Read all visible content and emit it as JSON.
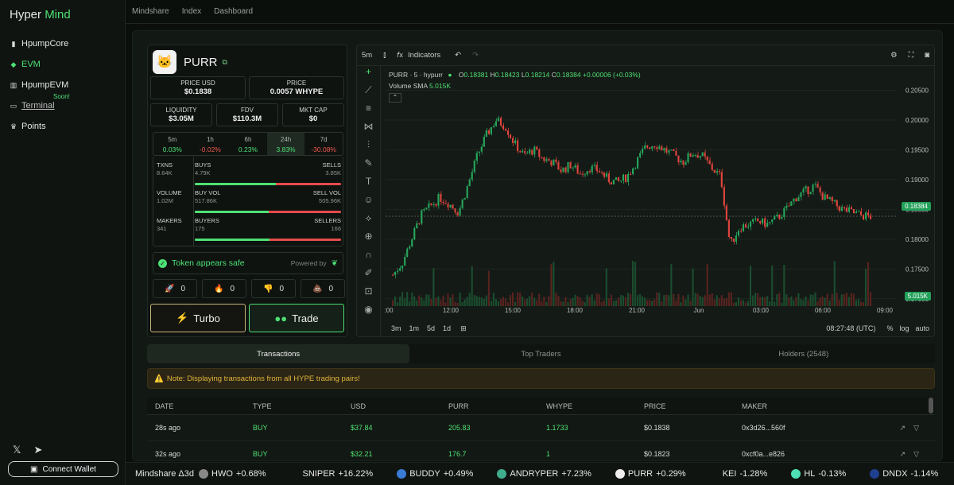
{
  "brand": {
    "part1": "Hyper",
    "part2": "Mind"
  },
  "sidebar": {
    "items": [
      {
        "label": "HpumpCore",
        "icon": "book-icon"
      },
      {
        "label": "EVM",
        "icon": "layers-icon"
      },
      {
        "label": "HpumpEVM",
        "icon": "bar-chart-icon"
      },
      {
        "label": "Terminal",
        "icon": "terminal-icon",
        "badge": "Soon!"
      },
      {
        "label": "Points",
        "icon": "trophy-icon"
      }
    ],
    "connect_label": "Connect Wallet"
  },
  "topnav": [
    "Mindshare",
    "Index",
    "Dashboard"
  ],
  "token": {
    "name": "PURR",
    "price_usd_label": "PRICE USD",
    "price_usd": "$0.1838",
    "price_label": "PRICE",
    "price": "0.0057 WHYPE",
    "liquidity_label": "LIQUIDITY",
    "liquidity": "$3.05M",
    "fdv_label": "FDV",
    "fdv": "$110.3M",
    "mcap_label": "MKT CAP",
    "mcap": "$0",
    "timeframes": [
      {
        "label": "5m",
        "pct": "0.03%",
        "dir": "pos"
      },
      {
        "label": "1h",
        "pct": "-0.02%",
        "dir": "neg"
      },
      {
        "label": "6h",
        "pct": "0.23%",
        "dir": "pos"
      },
      {
        "label": "24h",
        "pct": "3.83%",
        "dir": "pos"
      },
      {
        "label": "7d",
        "pct": "-30.08%",
        "dir": "neg"
      }
    ],
    "txns_label": "TXNS",
    "txns": "8.64K",
    "buys_label": "BUYS",
    "buys": "4.79K",
    "sells_label": "SELLS",
    "sells": "3.85K",
    "buys_ratio": 0.554,
    "volume_label": "VOLUME",
    "volume": "1.02M",
    "buyvol_label": "BUY VOL",
    "buyvol": "517.86K",
    "sellvol_label": "SELL VOL",
    "sellvol": "505.96K",
    "vol_ratio": 0.506,
    "makers_label": "MAKERS",
    "makers": "341",
    "buyers_label": "BUYERS",
    "buyers": "175",
    "sellers_label": "SELLERS",
    "sellers": "166",
    "makers_ratio": 0.513,
    "safe_text": "Token appears safe",
    "powered_by": "Powered by",
    "reactions": [
      {
        "icon": "rocket-icon",
        "glyph": "🚀",
        "count": "0"
      },
      {
        "icon": "fire-icon",
        "glyph": "🔥",
        "count": "0"
      },
      {
        "icon": "thumbs-down-icon",
        "glyph": "👎",
        "count": "0"
      },
      {
        "icon": "poop-icon",
        "glyph": "💩",
        "count": "0"
      }
    ],
    "turbo_label": "Turbo",
    "trade_label": "Trade"
  },
  "chart": {
    "interval": "5m",
    "indicators_label": "Indicators",
    "symbol_line": "PURR · 5 · hypurr",
    "ohlc": {
      "o": "0.18381",
      "h": "0.18423",
      "l": "0.18214",
      "c": "0.18384",
      "chg": "+0.00006 (+0.03%)"
    },
    "volume_label": "Volume SMA",
    "volume_value": "5.015K",
    "last_price": "0.18384",
    "last_volume": "5.015K",
    "time": "08:27:48 (UTC)",
    "ranges": [
      "3m",
      "1m",
      "5d",
      "1d"
    ],
    "scale_opts": [
      "%",
      "log",
      "auto"
    ]
  },
  "chart_data": {
    "type": "candlestick",
    "y_ticks": [
      "0.20500",
      "0.20000",
      "0.19500",
      "0.19000",
      "0.18500",
      "0.18000",
      "0.17500",
      "0.17000"
    ],
    "ylim": [
      0.1685,
      0.2072
    ],
    "x_ticks": [
      ":00",
      "12:00",
      "15:00",
      "18:00",
      "21:00",
      "Jun",
      "03:00",
      "06:00",
      "09:00"
    ],
    "close_path": [
      0.174,
      0.176,
      0.18,
      0.184,
      0.1855,
      0.187,
      0.186,
      0.1845,
      0.189,
      0.194,
      0.1975,
      0.2,
      0.199,
      0.196,
      0.194,
      0.195,
      0.1935,
      0.193,
      0.1915,
      0.1925,
      0.191,
      0.192,
      0.1915,
      0.19,
      0.1895,
      0.1905,
      0.193,
      0.1955,
      0.196,
      0.195,
      0.194,
      0.193,
      0.1945,
      0.194,
      0.192,
      0.1905,
      0.179,
      0.182,
      0.1825,
      0.183,
      0.1825,
      0.1835,
      0.185,
      0.187,
      0.188,
      0.189,
      0.187,
      0.186,
      0.185,
      0.1845,
      0.184,
      0.1838
    ]
  },
  "tabs": [
    "Transactions",
    "Top Traders",
    "Holders (2548)"
  ],
  "note": "Note: Displaying transactions from all HYPE trading pairs!",
  "table": {
    "headers": [
      "DATE",
      "TYPE",
      "USD",
      "PURR",
      "WHYPE",
      "PRICE",
      "MAKER"
    ],
    "rows": [
      [
        "28s ago",
        "BUY",
        "$37.84",
        "205.83",
        "1.1733",
        "$0.1838",
        "0x3d26...560f"
      ],
      [
        "32s ago",
        "BUY",
        "$32.21",
        "176.7",
        "1",
        "$0.1823",
        "0xcf0a...e826"
      ]
    ]
  },
  "ticker": {
    "label": "Mindshare Δ3d",
    "items": [
      {
        "name": "HWO",
        "chg": "+0.68%",
        "color": "#888888"
      },
      {
        "name": "SNIPER",
        "chg": "+16.22%",
        "color": "#0f1411"
      },
      {
        "name": "BUDDY",
        "chg": "+0.49%",
        "color": "#3a7bd5"
      },
      {
        "name": "ANDRYPER",
        "chg": "+7.23%",
        "color": "#3fae8c"
      },
      {
        "name": "PURR",
        "chg": "+0.29%",
        "color": "#eeeeee"
      },
      {
        "name": "KEI",
        "chg": "-1.28%",
        "color": "#0f1411"
      },
      {
        "name": "HL",
        "chg": "-0.13%",
        "color": "#4ee0b4"
      },
      {
        "name": "DNDX",
        "chg": "-1.14%",
        "color": "#1f3f8f"
      }
    ]
  }
}
